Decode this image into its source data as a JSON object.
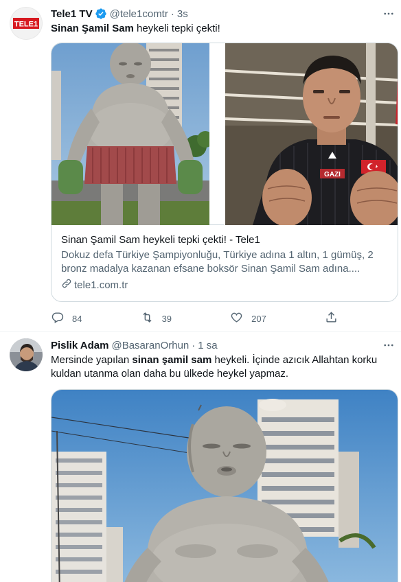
{
  "tweets": [
    {
      "author_name": "Tele1 TV",
      "author_handle": "@tele1comtr",
      "separator": "·",
      "time": "3s",
      "avatar_text": "TELE1",
      "text_bold": "Sinan Şamil Sam",
      "text_rest": " heykeli tepki çekti!",
      "card": {
        "title": "Sinan Şamil Sam heykeli tepki çekti! - Tele1",
        "description": "Dokuz defa Türkiye Şampiyonluğu, Türkiye adına 1 altın, 1 gümüş, 2 bronz madalya kazanan efsane boksör Sinan Şamil Sam adına....",
        "domain": "tele1.com.tr",
        "shirt_text": "GAZI"
      },
      "counts": {
        "replies": "84",
        "retweets": "39",
        "likes": "207"
      }
    },
    {
      "author_name": "Pislik Adam",
      "author_handle": "@BasaranOrhun",
      "separator": "·",
      "time": "1 sa",
      "text_before": "Mersinde yapılan ",
      "text_bold": "sinan şamil sam",
      "text_after": " heykeli. İçinde azıcık Allahtan korku kuldan utanma olan daha bu ülkede heykel yapmaz."
    }
  ],
  "colors": {
    "verified_blue": "#1d9bf0",
    "secondary_text": "#536471",
    "tele1_red": "#d71920"
  },
  "icons": [
    "verified-badge-icon",
    "more-icon",
    "link-icon",
    "reply-icon",
    "retweet-icon",
    "like-icon",
    "share-icon"
  ]
}
